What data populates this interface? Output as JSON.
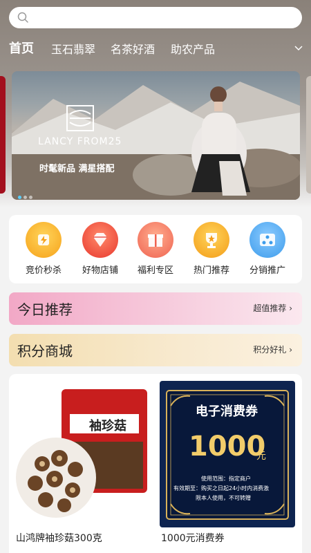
{
  "search": {
    "placeholder": ""
  },
  "tabs": [
    {
      "label": "首页",
      "active": true
    },
    {
      "label": "玉石翡翠"
    },
    {
      "label": "名茶好酒"
    },
    {
      "label": "助农产品"
    }
  ],
  "banner": {
    "brand": "LANCY FROM25",
    "slogan": "时髦新品 满星搭配"
  },
  "categories": [
    {
      "label": "竞价秒杀",
      "icon": "gavel-icon",
      "color": "#f6a21a"
    },
    {
      "label": "好物店铺",
      "icon": "gem-icon",
      "color": "#ee4a3a"
    },
    {
      "label": "福利专区",
      "icon": "gift-icon",
      "color": "#f2755c"
    },
    {
      "label": "热门推荐",
      "icon": "trophy-icon",
      "color": "#f3a21c"
    },
    {
      "label": "分销推广",
      "icon": "share-network-icon",
      "color": "#4aa7f0"
    }
  ],
  "today": {
    "title": "今日推荐",
    "more": "超值推荐"
  },
  "points": {
    "title": "积分商城",
    "more": "积分好礼"
  },
  "products": [
    {
      "name": "山鸿牌袖珍菇300克",
      "package_label": "袖珍菇"
    },
    {
      "name": "1000元消费券",
      "voucher": {
        "title": "电子消费券",
        "amount": "1000",
        "unit": "元",
        "line1": "使用范围：指定商户",
        "line2": "有效期至：购买之日起24小时内消费激",
        "line3": "限本人使用，不可转赠"
      }
    }
  ],
  "colors": {
    "today_strip": "#f2a8c6",
    "points_strip": "#f3deb0",
    "dot_active": "#5ad0ff"
  }
}
